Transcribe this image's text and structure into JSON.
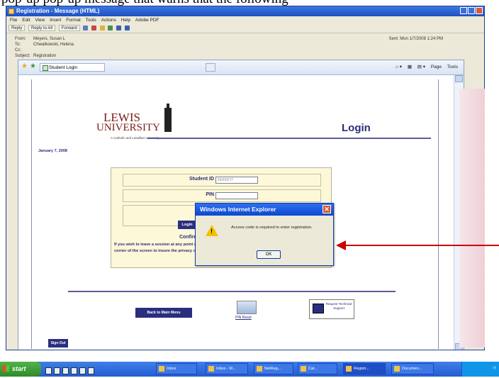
{
  "caption": "pop-up pop-up message that warns that the following",
  "outlook": {
    "title": "Registration - Message (HTML)",
    "menu": [
      "File",
      "Edit",
      "View",
      "Insert",
      "Format",
      "Tools",
      "Actions",
      "Help",
      "Adobe PDF"
    ],
    "toolbar": [
      "Reply",
      "Reply to All",
      "Forward"
    ],
    "from_label": "From:",
    "from_value": "Meyers, Susan L",
    "to_label": "To:",
    "to_value": "Chwalkowski, Helena",
    "cc_label": "Cc:",
    "subject_label": "Subject:",
    "subject_value": "Registration",
    "sent": "Sent: Mon 1/7/2008 1:24 PM"
  },
  "ie": {
    "tab_title": "Student Login",
    "tools": [
      "Page",
      "Tools"
    ]
  },
  "page": {
    "logo_line1": "LEWIS",
    "logo_line2": "UNIVERSITY",
    "logo_tagline": "A Catholic and Lasallian University",
    "title": "Login",
    "date": "January 7, 2008",
    "student_id_label": "Student ID",
    "student_id_value": "2XXXX77",
    "pin_label": "PIN",
    "login_button": "Login",
    "confirm_pin": "Confirm PIN",
    "notice": "If you wish to leave a session at any point after you're logged in, please use the 'Sign Out' link in the lower left corner of the screen to insure the privacy of your session.",
    "back_button": "Back to Main Menu",
    "pin_reset": "PIN Reset",
    "tech_support": "Request Technical Support",
    "signout_button": "Sign Out"
  },
  "dialog": {
    "title": "Windows Internet Explorer",
    "message": "Access code is required to enter registration.",
    "ok": "OK"
  },
  "taskbar": {
    "start": "start",
    "tasks": [
      "Inbox",
      "Inbox - M...",
      "NetReg...",
      "Cal...",
      "Registr...",
      "Documen..."
    ]
  },
  "colors": {
    "accent": "#2c2c7a",
    "arrow": "#cc0000",
    "taskbar": "#245dd3"
  }
}
